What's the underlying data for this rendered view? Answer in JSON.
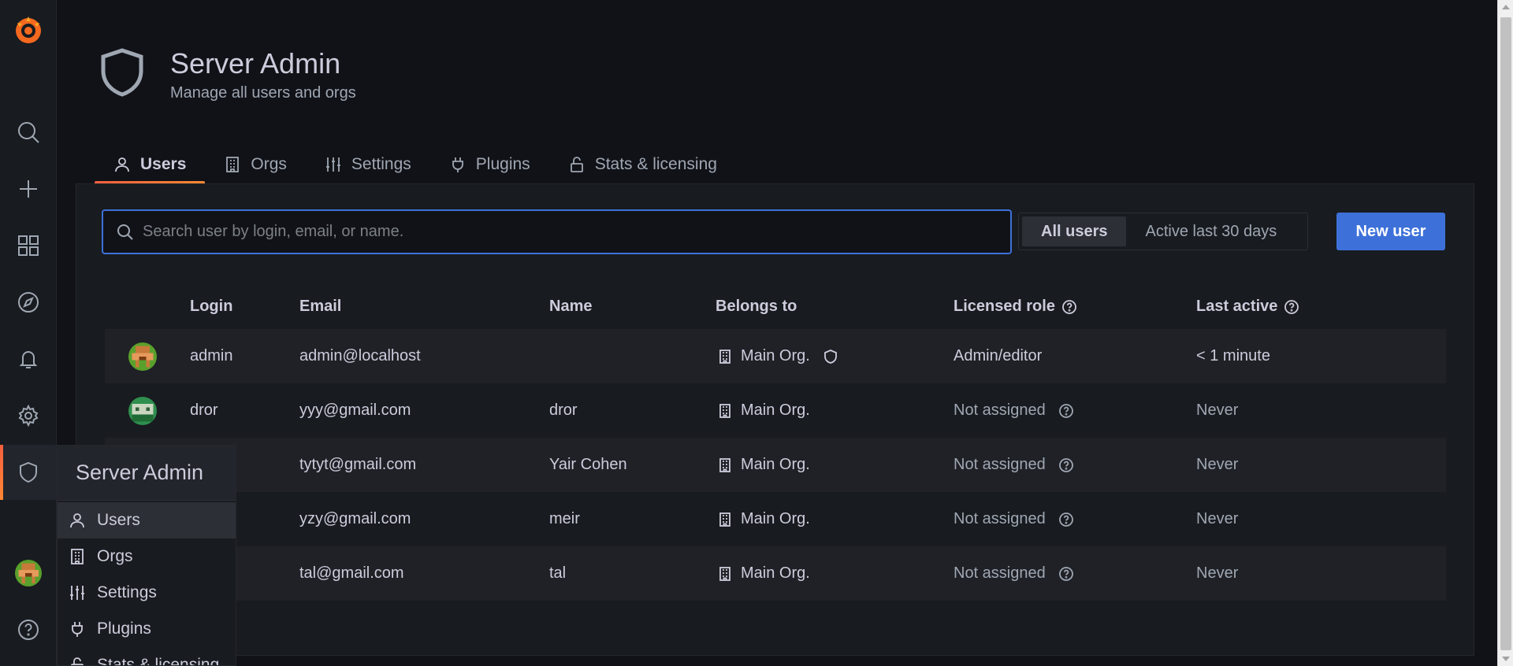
{
  "app": {
    "accent": "#3d71d9",
    "brand_gradient": [
      "#f55f3e",
      "#ff8833"
    ]
  },
  "sidebar": {
    "items": [
      "grafana-logo-icon",
      "search-icon",
      "plus-icon",
      "dashboards-icon",
      "explore-icon",
      "alerting-icon",
      "gear-icon",
      "shield-icon",
      "user-avatar",
      "help-icon"
    ]
  },
  "popout": {
    "title": "Server Admin",
    "items": [
      {
        "label": "Users",
        "icon": "user-icon"
      },
      {
        "label": "Orgs",
        "icon": "building-icon"
      },
      {
        "label": "Settings",
        "icon": "sliders-icon"
      },
      {
        "label": "Plugins",
        "icon": "plug-icon"
      },
      {
        "label": "Stats & licensing",
        "icon": "lock-icon"
      }
    ]
  },
  "header": {
    "title": "Server Admin",
    "subtitle": "Manage all users and orgs"
  },
  "tabs": [
    {
      "label": "Users",
      "icon": "user-icon",
      "active": true
    },
    {
      "label": "Orgs",
      "icon": "building-icon"
    },
    {
      "label": "Settings",
      "icon": "sliders-icon"
    },
    {
      "label": "Plugins",
      "icon": "plug-icon"
    },
    {
      "label": "Stats & licensing",
      "icon": "lock-icon"
    }
  ],
  "search": {
    "placeholder": "Search user by login, email, or name.",
    "value": ""
  },
  "filter": {
    "options": [
      "All users",
      "Active last 30 days"
    ],
    "selected": "All users"
  },
  "new_user_label": "New user",
  "table": {
    "headers": {
      "login": "Login",
      "email": "Email",
      "name": "Name",
      "belongs_to": "Belongs to",
      "licensed_role": "Licensed role",
      "last_active": "Last active"
    },
    "rows": [
      {
        "login": "admin",
        "email": "admin@localhost",
        "name": "",
        "belongs_to": "Main Org.",
        "role": "Admin/editor",
        "last_active": "< 1 minute",
        "admin": true
      },
      {
        "login": "dror",
        "email": "yyy@gmail.com",
        "name": "dror",
        "belongs_to": "Main Org.",
        "role": "Not assigned",
        "last_active": "Never"
      },
      {
        "login": "",
        "email": "tytyt@gmail.com",
        "name": "Yair Cohen",
        "belongs_to": "Main Org.",
        "role": "Not assigned",
        "last_active": "Never"
      },
      {
        "login": "",
        "email": "yzy@gmail.com",
        "name": "meir",
        "belongs_to": "Main Org.",
        "role": "Not assigned",
        "last_active": "Never"
      },
      {
        "login": "",
        "email": "tal@gmail.com",
        "name": "tal",
        "belongs_to": "Main Org.",
        "role": "Not assigned",
        "last_active": "Never"
      }
    ]
  }
}
